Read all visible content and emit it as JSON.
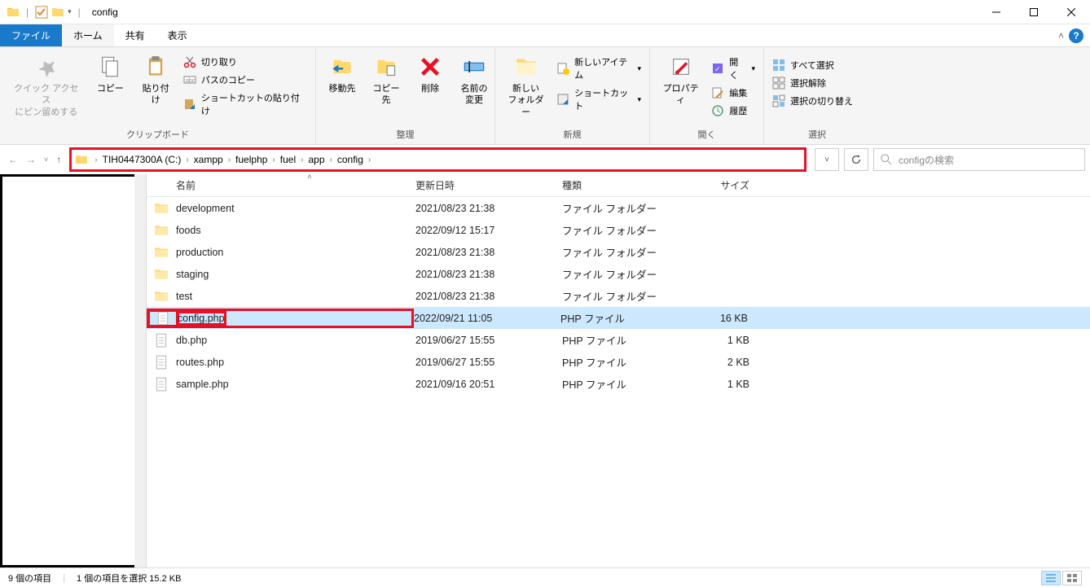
{
  "window": {
    "title": "config"
  },
  "tabs": {
    "file": "ファイル",
    "home": "ホーム",
    "share": "共有",
    "view": "表示"
  },
  "ribbon": {
    "clipboard": {
      "label": "クリップボード",
      "pin": "クイック アクセス\nにピン留めする",
      "copy": "コピー",
      "paste": "貼り付け",
      "cut": "切り取り",
      "copy_path": "パスのコピー",
      "paste_shortcut": "ショートカットの貼り付け"
    },
    "organize": {
      "label": "整理",
      "move_to": "移動先",
      "copy_to": "コピー先",
      "delete": "削除",
      "rename": "名前の\n変更"
    },
    "new": {
      "label": "新規",
      "new_folder": "新しい\nフォルダー",
      "new_item": "新しいアイテム",
      "shortcut": "ショートカット"
    },
    "open": {
      "label": "開く",
      "properties": "プロパティ",
      "open": "開く",
      "edit": "編集",
      "history": "履歴"
    },
    "select": {
      "label": "選択",
      "select_all": "すべて選択",
      "select_none": "選択解除",
      "invert": "選択の切り替え"
    }
  },
  "breadcrumb": [
    "TIH0447300A (C:)",
    "xampp",
    "fuelphp",
    "fuel",
    "app",
    "config"
  ],
  "search_placeholder": "configの検索",
  "columns": {
    "name": "名前",
    "date": "更新日時",
    "type": "種類",
    "size": "サイズ"
  },
  "files": [
    {
      "name": "development",
      "date": "2021/08/23 21:38",
      "type": "ファイル フォルダー",
      "size": "",
      "kind": "folder",
      "selected": false,
      "highlighted": false
    },
    {
      "name": "foods",
      "date": "2022/09/12 15:17",
      "type": "ファイル フォルダー",
      "size": "",
      "kind": "folder",
      "selected": false,
      "highlighted": false
    },
    {
      "name": "production",
      "date": "2021/08/23 21:38",
      "type": "ファイル フォルダー",
      "size": "",
      "kind": "folder",
      "selected": false,
      "highlighted": false
    },
    {
      "name": "staging",
      "date": "2021/08/23 21:38",
      "type": "ファイル フォルダー",
      "size": "",
      "kind": "folder",
      "selected": false,
      "highlighted": false
    },
    {
      "name": "test",
      "date": "2021/08/23 21:38",
      "type": "ファイル フォルダー",
      "size": "",
      "kind": "folder",
      "selected": false,
      "highlighted": false
    },
    {
      "name": "config.php",
      "date": "2022/09/21 11:05",
      "type": "PHP ファイル",
      "size": "16 KB",
      "kind": "file",
      "selected": true,
      "highlighted": true
    },
    {
      "name": "db.php",
      "date": "2019/06/27 15:55",
      "type": "PHP ファイル",
      "size": "1 KB",
      "kind": "file",
      "selected": false,
      "highlighted": false
    },
    {
      "name": "routes.php",
      "date": "2019/06/27 15:55",
      "type": "PHP ファイル",
      "size": "2 KB",
      "kind": "file",
      "selected": false,
      "highlighted": false
    },
    {
      "name": "sample.php",
      "date": "2021/09/16 20:51",
      "type": "PHP ファイル",
      "size": "1 KB",
      "kind": "file",
      "selected": false,
      "highlighted": false
    }
  ],
  "status": {
    "count": "9 個の項目",
    "selected": "1 個の項目を選択 15.2 KB"
  }
}
